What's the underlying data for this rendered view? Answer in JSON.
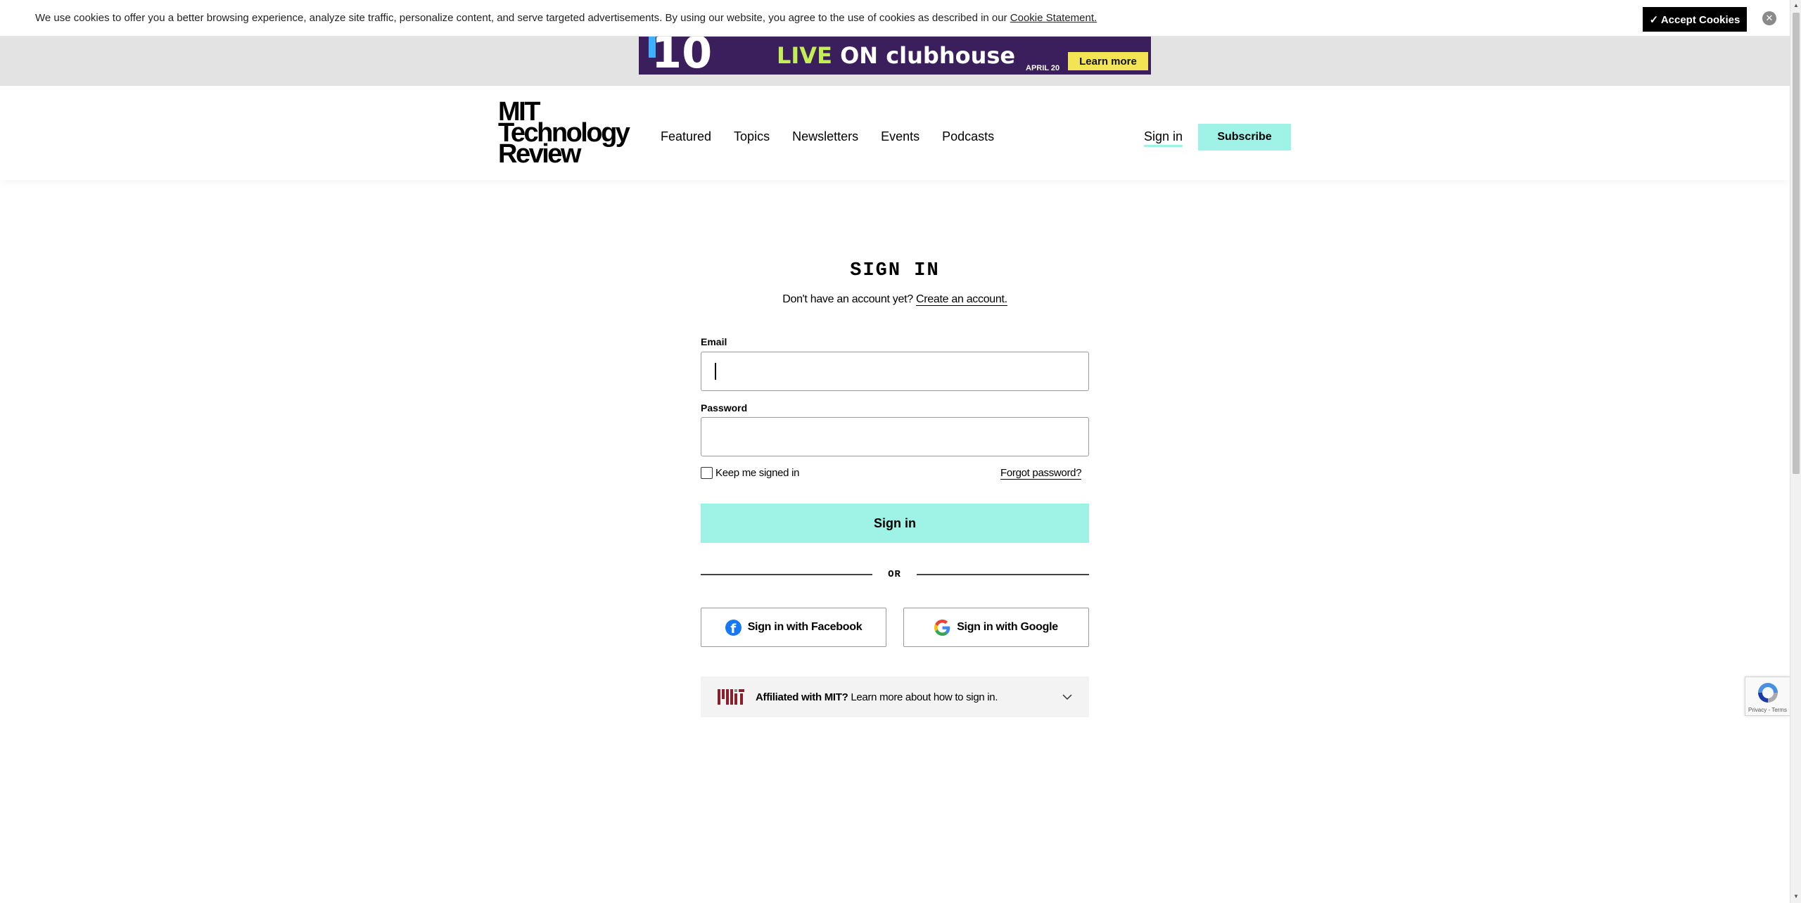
{
  "cookie": {
    "text": "We use cookies to offer you a better browsing experience, analyze site traffic, personalize content, and serve targeted advertisements. By using our website, you agree to the use of cookies as described in our ",
    "link": "Cookie Statement.",
    "accept": "✓ Accept Cookies",
    "close": "✕"
  },
  "ad": {
    "number": "10",
    "headline_live": "LIVE",
    "headline_on": " ON clubhouse",
    "date": "APRIL 20",
    "cta": "Learn more",
    "bg_color": "#3b1e5c"
  },
  "header": {
    "logo": [
      "MIT",
      "Technology",
      "Review"
    ],
    "nav": [
      "Featured",
      "Topics",
      "Newsletters",
      "Events",
      "Podcasts"
    ],
    "signin": "Sign in",
    "subscribe": "Subscribe",
    "accent_color": "#9ff2e6"
  },
  "form": {
    "title": "SIGN IN",
    "no_account": "Don't have an account yet? ",
    "create_link": "Create an account.",
    "email_label": "Email",
    "email_value": "",
    "password_label": "Password",
    "password_value": "",
    "keep_signed_in": "Keep me signed in",
    "keep_checked": false,
    "forgot": "Forgot password?",
    "submit": "Sign in",
    "or": "OR",
    "facebook": "Sign in with Facebook",
    "google": "Sign in with Google",
    "mit_bold": "Affiliated with MIT?",
    "mit_rest": " Learn more about how to sign in."
  },
  "recaptcha": {
    "text": "Privacy - Terms"
  }
}
